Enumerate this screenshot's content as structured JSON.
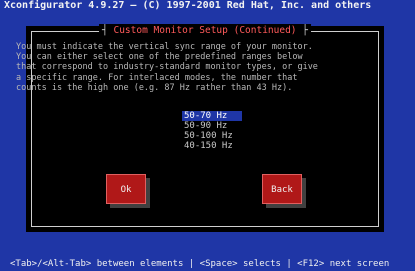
{
  "window": {
    "title": "Xconfigurator 4.9.27 — (C) 1997-2001 Red Hat, Inc. and others"
  },
  "dialog": {
    "title": "Custom Monitor Setup (Continued)",
    "message_lines": [
      "You must indicate the vertical sync range of your monitor.",
      "You can either select one of the predefined ranges below",
      "that correspond to industry-standard monitor types, or give",
      "a specific range. For interlaced modes, the number that",
      "counts is the high one (e.g. 87 Hz rather than 43 Hz)."
    ],
    "options": [
      "50-70 Hz",
      "50-90 Hz",
      "50-100 Hz",
      "40-150 Hz"
    ],
    "selected_option": "50-70 Hz",
    "ok_label": "Ok",
    "back_label": "Back"
  },
  "help_bar": {
    "text": "<Tab>/<Alt-Tab> between elements  |  <Space> selects  |  <F12> next screen"
  },
  "colors": {
    "background": "#1f36a6",
    "dialog": "#000000",
    "button": "#b01818",
    "title_accent": "#ff5a5a"
  }
}
